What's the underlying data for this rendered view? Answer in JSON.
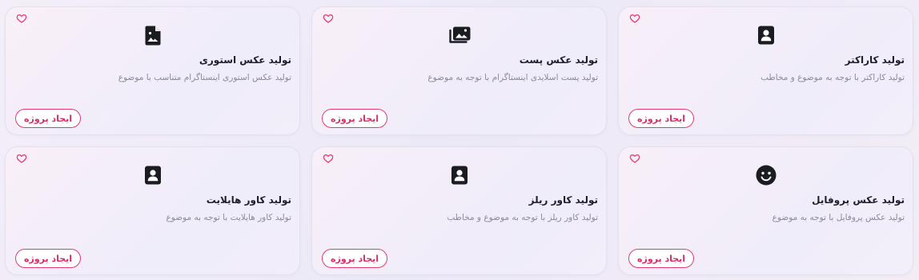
{
  "colors": {
    "accent": "#e23a76",
    "title": "#1f1f29",
    "desc": "#8b8a96"
  },
  "cards": [
    {
      "title": "تولید کاراکتر",
      "desc": "تولید کاراکتر با توجه به موضوع و مخاطب",
      "button": "ایجاد پروژه",
      "icon": "portrait-icon"
    },
    {
      "title": "تولید عکس پست",
      "desc": "تولید پست اسلایدی اینستاگرام با توجه به موضوع",
      "button": "ایجاد پروژه",
      "icon": "photo-library-icon"
    },
    {
      "title": "تولید عکس استوری",
      "desc": "تولید عکس استوری اینستاگرام متناسب با موضوع",
      "button": "ایجاد پروژه",
      "icon": "image-file-icon"
    },
    {
      "title": "تولید عکس پروفایل",
      "desc": "تولید عکس پروفایل با توجه به موضوع",
      "button": "ایجاد پروژه",
      "icon": "smiley-face-icon"
    },
    {
      "title": "تولید کاور ریلز",
      "desc": "تولید کاور ریلز با توجه به موضوع و مخاطب",
      "button": "ایجاد پروژه",
      "icon": "portrait-icon"
    },
    {
      "title": "تولید کاور هایلایت",
      "desc": "تولید کاور هایلایت با توجه به موضوع",
      "button": "ایجاد پروژه",
      "icon": "portrait-icon"
    }
  ]
}
